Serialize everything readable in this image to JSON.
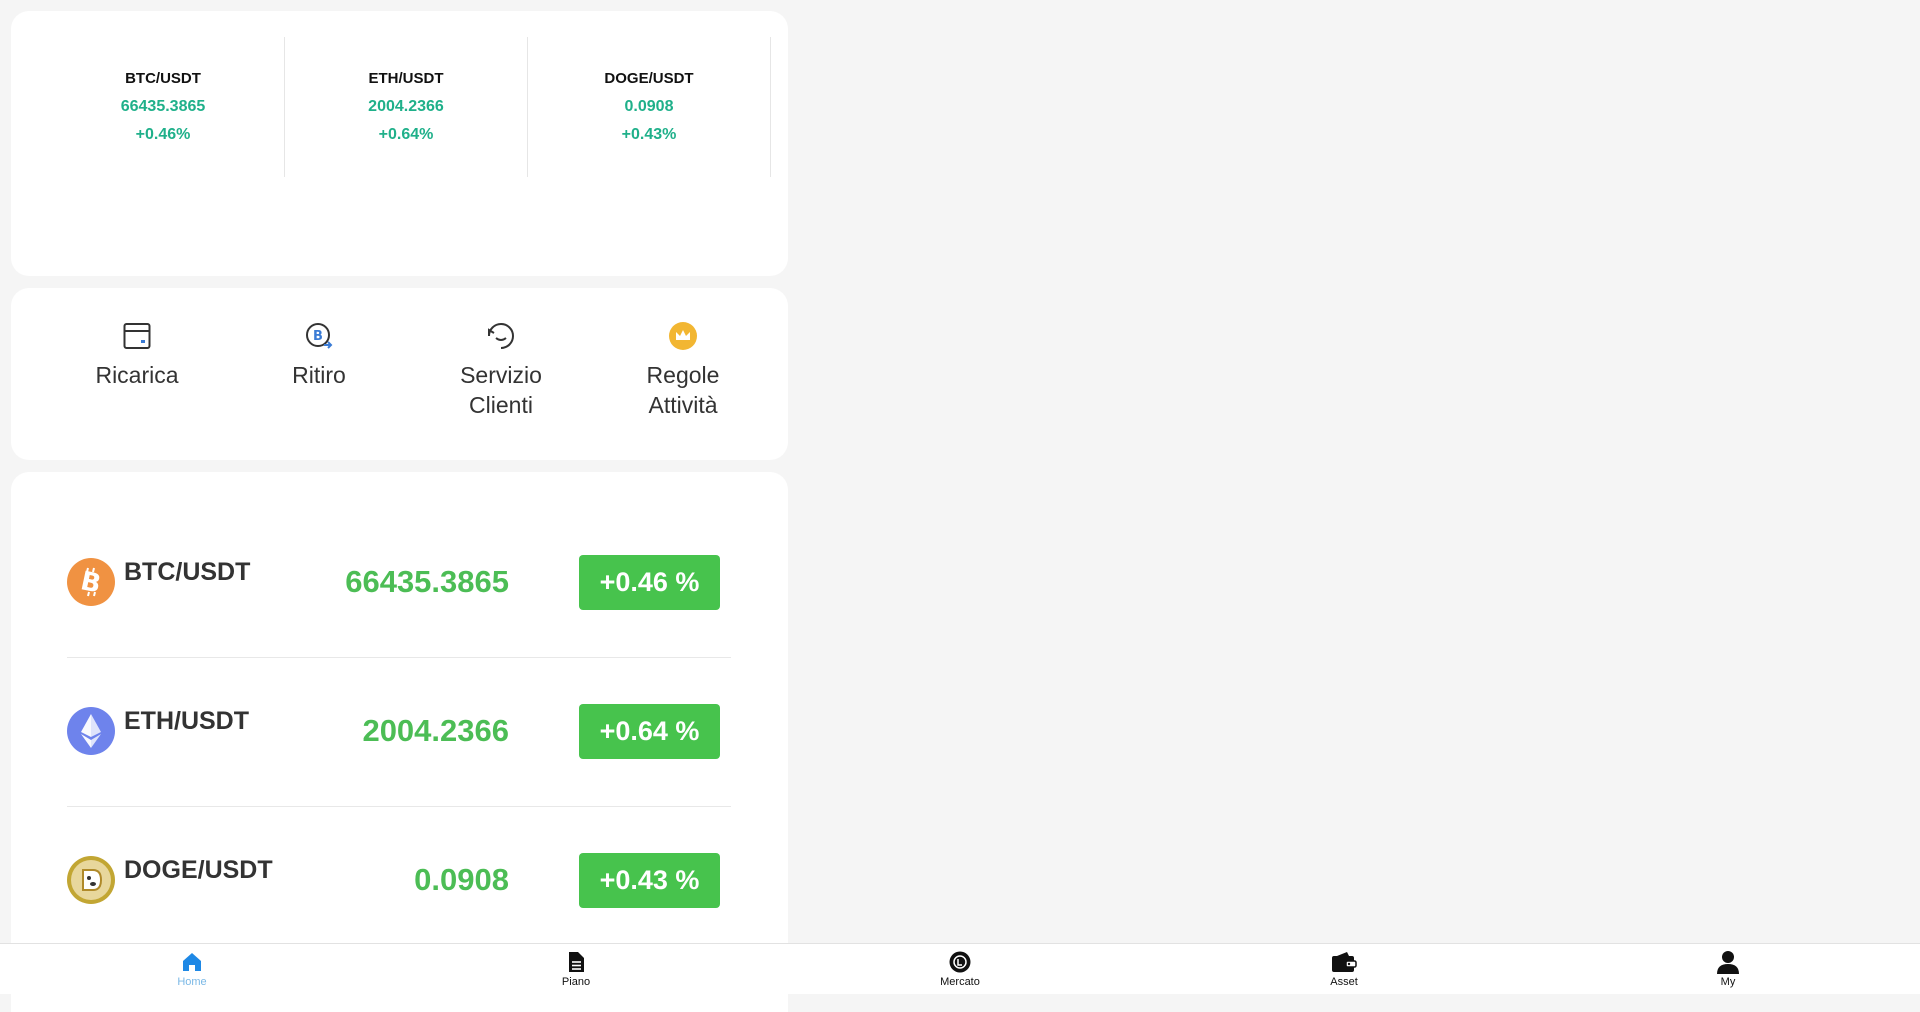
{
  "tickers": [
    {
      "pair": "BTC/USDT",
      "price": "66435.3865",
      "change": "+0.46%"
    },
    {
      "pair": "ETH/USDT",
      "price": "2004.2366",
      "change": "+0.64%"
    },
    {
      "pair": "DOGE/USDT",
      "price": "0.0908",
      "change": "+0.43%"
    }
  ],
  "actions": [
    {
      "label": "Ricarica",
      "icon": "deposit-card-icon"
    },
    {
      "label": "Ritiro",
      "icon": "bitcoin-withdraw-icon"
    },
    {
      "label": "Servizio Clienti",
      "icon": "customer-service-icon"
    },
    {
      "label": "Regole Attività",
      "icon": "crown-icon"
    }
  ],
  "market": [
    {
      "pair": "BTC/USDT",
      "price": "66435.3865",
      "change": "+0.46 %",
      "icon": "bitcoin-icon",
      "color": "#f09242"
    },
    {
      "pair": "ETH/USDT",
      "price": "2004.2366",
      "change": "+0.64 %",
      "icon": "ethereum-icon",
      "color": "#6e83ec"
    },
    {
      "pair": "DOGE/USDT",
      "price": "0.0908",
      "change": "+0.43 %",
      "icon": "dogecoin-icon",
      "color": "#c2a633"
    }
  ],
  "tabs": [
    {
      "label": "Home",
      "icon": "home-icon",
      "active": true
    },
    {
      "label": "Piano",
      "icon": "document-icon",
      "active": false
    },
    {
      "label": "Mercato",
      "icon": "market-icon",
      "active": false
    },
    {
      "label": "Asset",
      "icon": "wallet-icon",
      "active": false
    },
    {
      "label": "My",
      "icon": "user-icon",
      "active": false
    }
  ],
  "colors": {
    "up": "#1fb08a",
    "badge": "#47c34d",
    "price": "#4cbd55",
    "active_tab": "#7ab8e6"
  }
}
